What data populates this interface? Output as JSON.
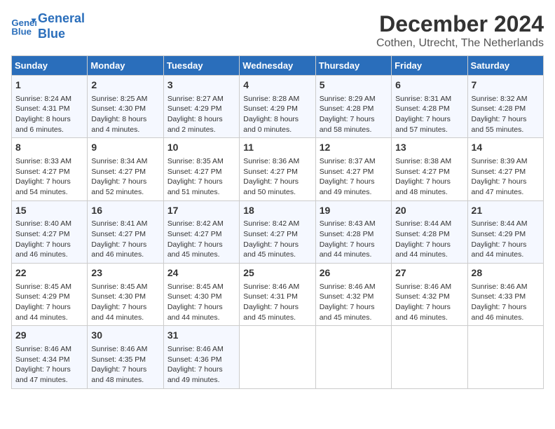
{
  "header": {
    "logo_line1": "General",
    "logo_line2": "Blue",
    "title": "December 2024",
    "subtitle": "Cothen, Utrecht, The Netherlands"
  },
  "columns": [
    "Sunday",
    "Monday",
    "Tuesday",
    "Wednesday",
    "Thursday",
    "Friday",
    "Saturday"
  ],
  "weeks": [
    [
      {
        "day": "1",
        "info": "Sunrise: 8:24 AM\nSunset: 4:31 PM\nDaylight: 8 hours\nand 6 minutes."
      },
      {
        "day": "2",
        "info": "Sunrise: 8:25 AM\nSunset: 4:30 PM\nDaylight: 8 hours\nand 4 minutes."
      },
      {
        "day": "3",
        "info": "Sunrise: 8:27 AM\nSunset: 4:29 PM\nDaylight: 8 hours\nand 2 minutes."
      },
      {
        "day": "4",
        "info": "Sunrise: 8:28 AM\nSunset: 4:29 PM\nDaylight: 8 hours\nand 0 minutes."
      },
      {
        "day": "5",
        "info": "Sunrise: 8:29 AM\nSunset: 4:28 PM\nDaylight: 7 hours\nand 58 minutes."
      },
      {
        "day": "6",
        "info": "Sunrise: 8:31 AM\nSunset: 4:28 PM\nDaylight: 7 hours\nand 57 minutes."
      },
      {
        "day": "7",
        "info": "Sunrise: 8:32 AM\nSunset: 4:28 PM\nDaylight: 7 hours\nand 55 minutes."
      }
    ],
    [
      {
        "day": "8",
        "info": "Sunrise: 8:33 AM\nSunset: 4:27 PM\nDaylight: 7 hours\nand 54 minutes."
      },
      {
        "day": "9",
        "info": "Sunrise: 8:34 AM\nSunset: 4:27 PM\nDaylight: 7 hours\nand 52 minutes."
      },
      {
        "day": "10",
        "info": "Sunrise: 8:35 AM\nSunset: 4:27 PM\nDaylight: 7 hours\nand 51 minutes."
      },
      {
        "day": "11",
        "info": "Sunrise: 8:36 AM\nSunset: 4:27 PM\nDaylight: 7 hours\nand 50 minutes."
      },
      {
        "day": "12",
        "info": "Sunrise: 8:37 AM\nSunset: 4:27 PM\nDaylight: 7 hours\nand 49 minutes."
      },
      {
        "day": "13",
        "info": "Sunrise: 8:38 AM\nSunset: 4:27 PM\nDaylight: 7 hours\nand 48 minutes."
      },
      {
        "day": "14",
        "info": "Sunrise: 8:39 AM\nSunset: 4:27 PM\nDaylight: 7 hours\nand 47 minutes."
      }
    ],
    [
      {
        "day": "15",
        "info": "Sunrise: 8:40 AM\nSunset: 4:27 PM\nDaylight: 7 hours\nand 46 minutes."
      },
      {
        "day": "16",
        "info": "Sunrise: 8:41 AM\nSunset: 4:27 PM\nDaylight: 7 hours\nand 46 minutes."
      },
      {
        "day": "17",
        "info": "Sunrise: 8:42 AM\nSunset: 4:27 PM\nDaylight: 7 hours\nand 45 minutes."
      },
      {
        "day": "18",
        "info": "Sunrise: 8:42 AM\nSunset: 4:27 PM\nDaylight: 7 hours\nand 45 minutes."
      },
      {
        "day": "19",
        "info": "Sunrise: 8:43 AM\nSunset: 4:28 PM\nDaylight: 7 hours\nand 44 minutes."
      },
      {
        "day": "20",
        "info": "Sunrise: 8:44 AM\nSunset: 4:28 PM\nDaylight: 7 hours\nand 44 minutes."
      },
      {
        "day": "21",
        "info": "Sunrise: 8:44 AM\nSunset: 4:29 PM\nDaylight: 7 hours\nand 44 minutes."
      }
    ],
    [
      {
        "day": "22",
        "info": "Sunrise: 8:45 AM\nSunset: 4:29 PM\nDaylight: 7 hours\nand 44 minutes."
      },
      {
        "day": "23",
        "info": "Sunrise: 8:45 AM\nSunset: 4:30 PM\nDaylight: 7 hours\nand 44 minutes."
      },
      {
        "day": "24",
        "info": "Sunrise: 8:45 AM\nSunset: 4:30 PM\nDaylight: 7 hours\nand 44 minutes."
      },
      {
        "day": "25",
        "info": "Sunrise: 8:46 AM\nSunset: 4:31 PM\nDaylight: 7 hours\nand 45 minutes."
      },
      {
        "day": "26",
        "info": "Sunrise: 8:46 AM\nSunset: 4:32 PM\nDaylight: 7 hours\nand 45 minutes."
      },
      {
        "day": "27",
        "info": "Sunrise: 8:46 AM\nSunset: 4:32 PM\nDaylight: 7 hours\nand 46 minutes."
      },
      {
        "day": "28",
        "info": "Sunrise: 8:46 AM\nSunset: 4:33 PM\nDaylight: 7 hours\nand 46 minutes."
      }
    ],
    [
      {
        "day": "29",
        "info": "Sunrise: 8:46 AM\nSunset: 4:34 PM\nDaylight: 7 hours\nand 47 minutes."
      },
      {
        "day": "30",
        "info": "Sunrise: 8:46 AM\nSunset: 4:35 PM\nDaylight: 7 hours\nand 48 minutes."
      },
      {
        "day": "31",
        "info": "Sunrise: 8:46 AM\nSunset: 4:36 PM\nDaylight: 7 hours\nand 49 minutes."
      },
      {
        "day": "",
        "info": ""
      },
      {
        "day": "",
        "info": ""
      },
      {
        "day": "",
        "info": ""
      },
      {
        "day": "",
        "info": ""
      }
    ]
  ]
}
